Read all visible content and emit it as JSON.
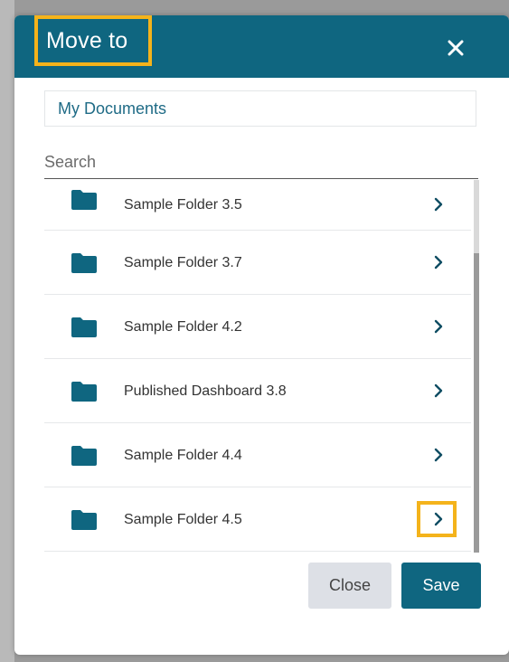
{
  "dialog": {
    "title": "Move to",
    "breadcrumb": "My Documents",
    "search": {
      "placeholder": "Search",
      "value": ""
    },
    "folders": [
      {
        "label": "Sample Folder 3.5"
      },
      {
        "label": "Sample Folder 3.7"
      },
      {
        "label": "Sample Folder 4.2"
      },
      {
        "label": "Published Dashboard 3.8"
      },
      {
        "label": "Sample Folder 4.4"
      },
      {
        "label": "Sample Folder 4.5"
      }
    ],
    "buttons": {
      "close": "Close",
      "save": "Save"
    },
    "icons": {
      "folder": "folder-icon",
      "chevron": "chevron-right-icon",
      "close": "close-icon"
    }
  },
  "colors": {
    "header": "#0f6680",
    "highlight": "#f4b31b",
    "accent_text": "#1f6b86"
  }
}
